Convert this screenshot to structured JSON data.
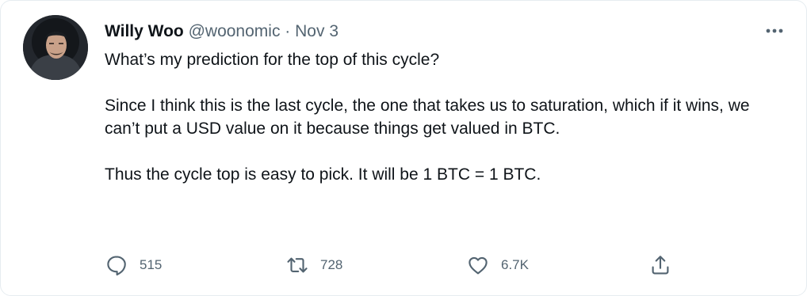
{
  "author": {
    "name": "Willy Woo",
    "handle": "@woonomic",
    "separator": "·",
    "date": "Nov 3"
  },
  "tweet": {
    "lines": [
      "What’s my prediction for the top of this cycle?",
      "Since I think this is the last cycle, the one that takes us to saturation, which if it wins, we can’t put a USD value on it because things get valued in BTC.",
      "Thus the cycle top is easy to pick. It will be 1 BTC = 1 BTC."
    ]
  },
  "actions": {
    "replies": "515",
    "retweets": "728",
    "likes": "6.7K"
  },
  "icons": {
    "more": "more-horizontal-icon",
    "reply": "reply-icon",
    "retweet": "retweet-icon",
    "like": "heart-icon",
    "share": "share-icon"
  },
  "colors": {
    "text_primary": "#0f1419",
    "text_secondary": "#536471",
    "border": "#e6ecf0"
  }
}
